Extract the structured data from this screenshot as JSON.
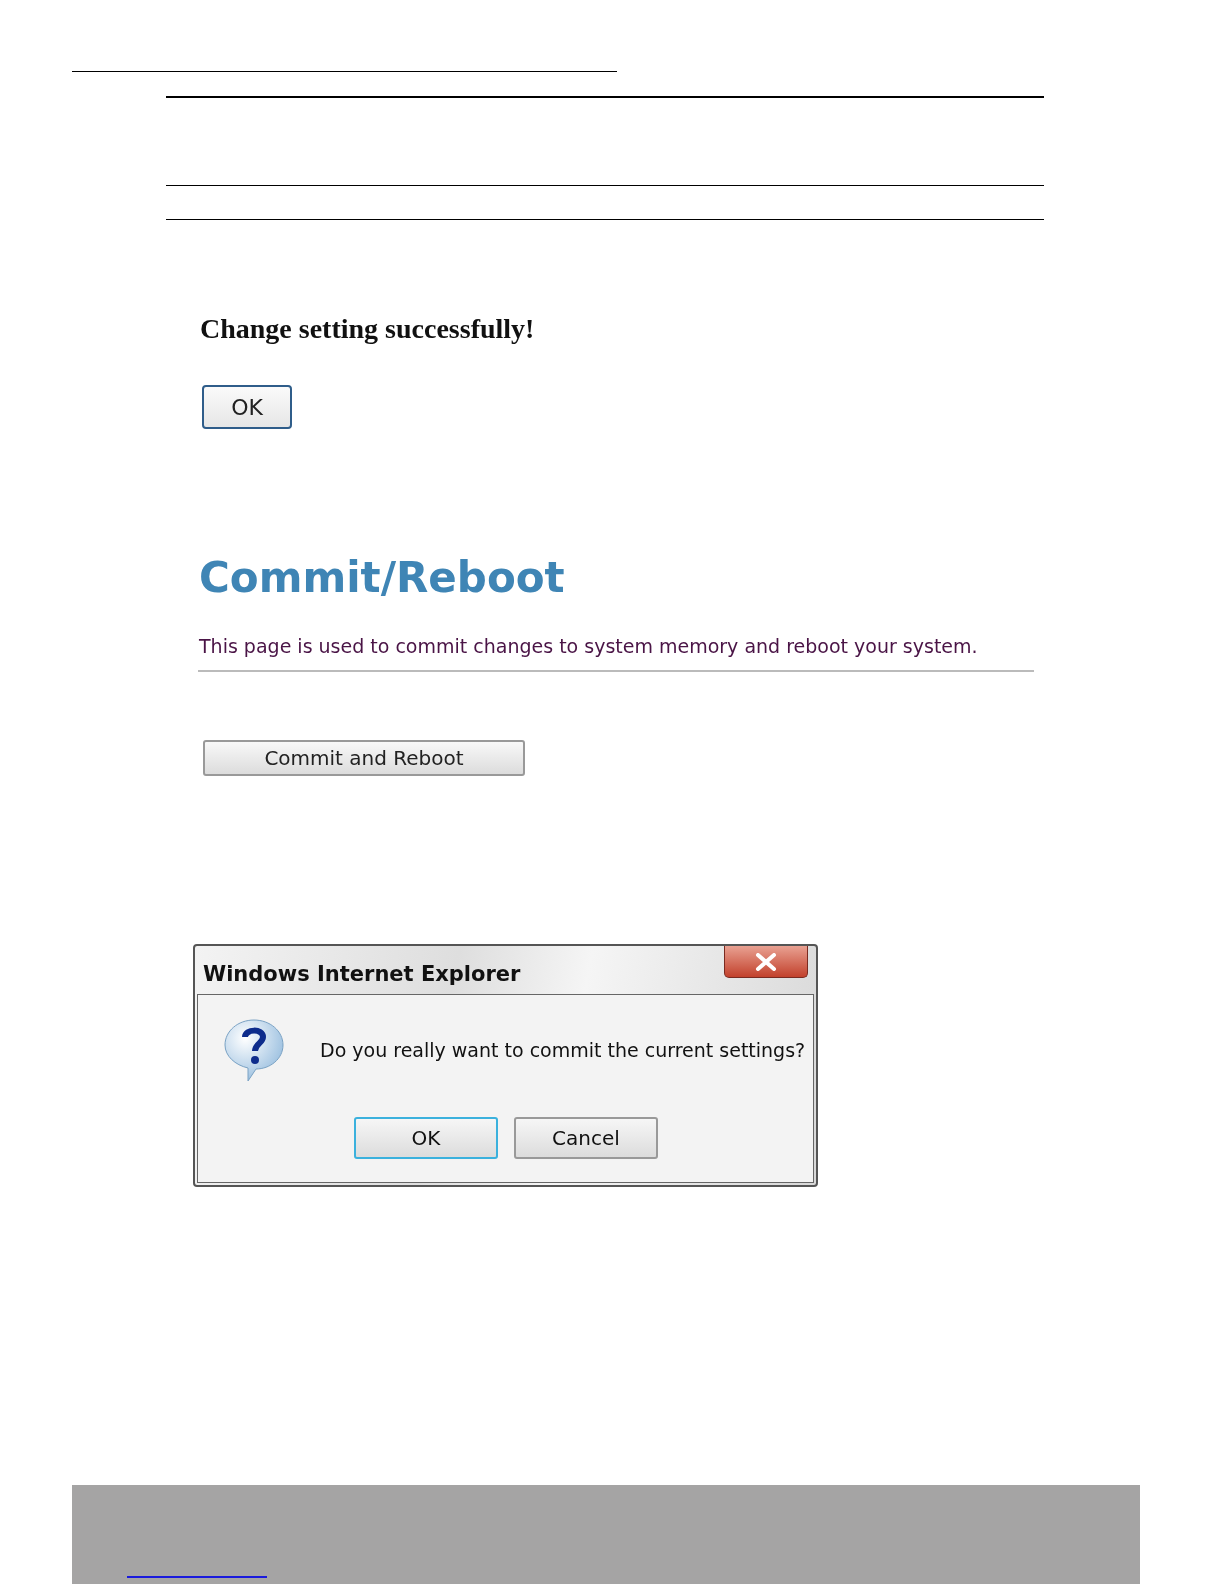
{
  "success_page": {
    "message": "Change setting successfully!",
    "ok_button": "OK"
  },
  "commit_page": {
    "title": "Commit/Reboot",
    "description": "This page is used to commit changes to system memory and reboot your system.",
    "button": "Commit and Reboot"
  },
  "dialog": {
    "title": "Windows Internet Explorer",
    "message": "Do you really want to commit the current settings?",
    "buttons": [
      {
        "label": "OK",
        "focused": true
      },
      {
        "label": "Cancel",
        "focused": false
      }
    ]
  }
}
